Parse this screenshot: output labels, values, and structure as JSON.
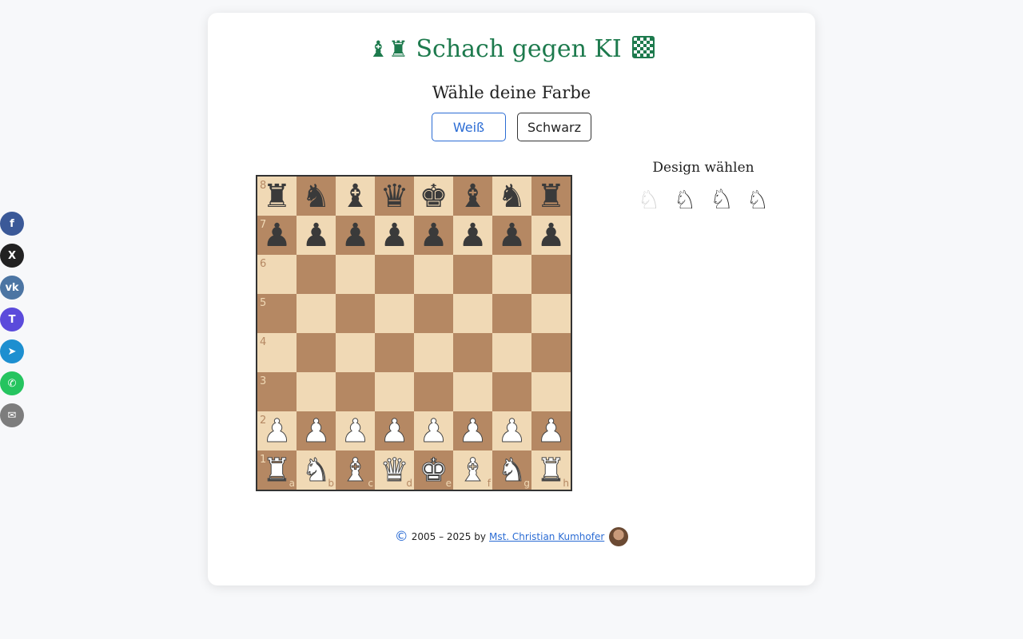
{
  "header": {
    "title": "Schach gegen KI",
    "title_icon": "chess-pieces-icon",
    "title_trailing_icon": "chessboard-icon"
  },
  "color_choice": {
    "heading": "Wähle deine Farbe",
    "white_label": "Weiß",
    "black_label": "Schwarz"
  },
  "board": {
    "light_color": "#f0d9b5",
    "dark_color": "#b58863",
    "ranks": [
      "8",
      "7",
      "6",
      "5",
      "4",
      "3",
      "2",
      "1"
    ],
    "files": [
      "a",
      "b",
      "c",
      "d",
      "e",
      "f",
      "g",
      "h"
    ],
    "position": [
      [
        "bR",
        "bN",
        "bB",
        "bQ",
        "bK",
        "bB",
        "bN",
        "bR"
      ],
      [
        "bP",
        "bP",
        "bP",
        "bP",
        "bP",
        "bP",
        "bP",
        "bP"
      ],
      [
        "",
        "",
        "",
        "",
        "",
        "",
        "",
        ""
      ],
      [
        "",
        "",
        "",
        "",
        "",
        "",
        "",
        ""
      ],
      [
        "",
        "",
        "",
        "",
        "",
        "",
        "",
        ""
      ],
      [
        "",
        "",
        "",
        "",
        "",
        "",
        "",
        ""
      ],
      [
        "wP",
        "wP",
        "wP",
        "wP",
        "wP",
        "wP",
        "wP",
        "wP"
      ],
      [
        "wR",
        "wN",
        "wB",
        "wQ",
        "wK",
        "wB",
        "wN",
        "wR"
      ]
    ]
  },
  "design": {
    "heading": "Design wählen",
    "options": [
      {
        "name": "light-knight-icon"
      },
      {
        "name": "outline-knight-icon"
      },
      {
        "name": "classic-knight-icon"
      },
      {
        "name": "sketch-knight-icon"
      }
    ]
  },
  "footer": {
    "copyright_symbol": "©",
    "years": "2005 – 2025 by",
    "author": "Mst. Christian Kumhofer"
  },
  "share": [
    {
      "name": "facebook-icon",
      "glyph": "f",
      "color": "#3b5998"
    },
    {
      "name": "x-twitter-icon",
      "glyph": "X",
      "color": "#222222"
    },
    {
      "name": "vk-icon",
      "glyph": "vk",
      "color": "#4c75a3"
    },
    {
      "name": "threads-icon",
      "glyph": "T",
      "color": "#5b4bdb"
    },
    {
      "name": "telegram-icon",
      "glyph": "➤",
      "color": "#1d8fd0"
    },
    {
      "name": "whatsapp-icon",
      "glyph": "✆",
      "color": "#25c45f"
    },
    {
      "name": "email-icon",
      "glyph": "✉",
      "color": "#7d7d7d"
    }
  ]
}
